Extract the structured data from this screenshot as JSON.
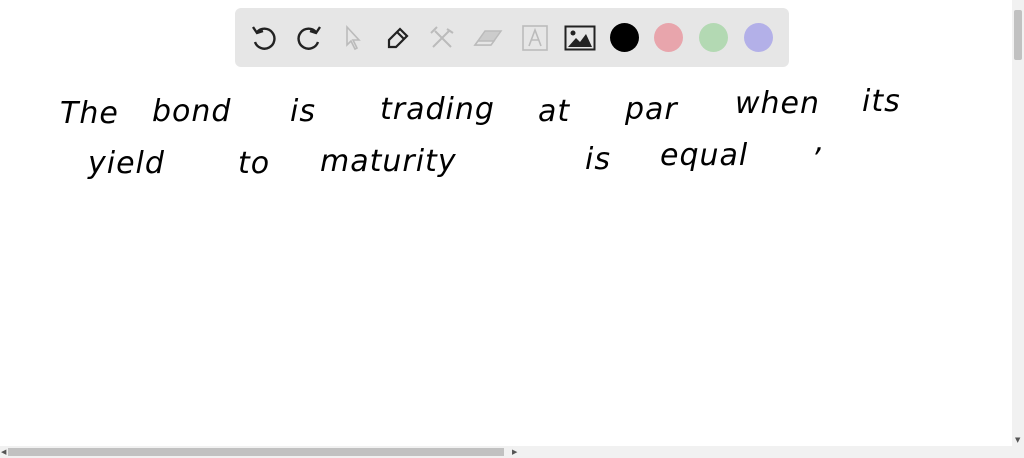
{
  "toolbar": {
    "tools": [
      "undo-icon",
      "redo-icon",
      "select-icon",
      "pen-icon",
      "tools-icon",
      "eraser-icon",
      "text-icon",
      "image-icon"
    ],
    "colors": {
      "black": "#000000",
      "pink": "#e8a5ac",
      "green": "#b3d9b3",
      "purple": "#b3b0e8"
    }
  },
  "canvas": {
    "line1": [
      "The",
      "bond",
      "is",
      "trading",
      "at",
      "par",
      "when",
      "its"
    ],
    "line2": [
      "yield",
      "to",
      "maturity",
      "is",
      "equal",
      ","
    ]
  }
}
